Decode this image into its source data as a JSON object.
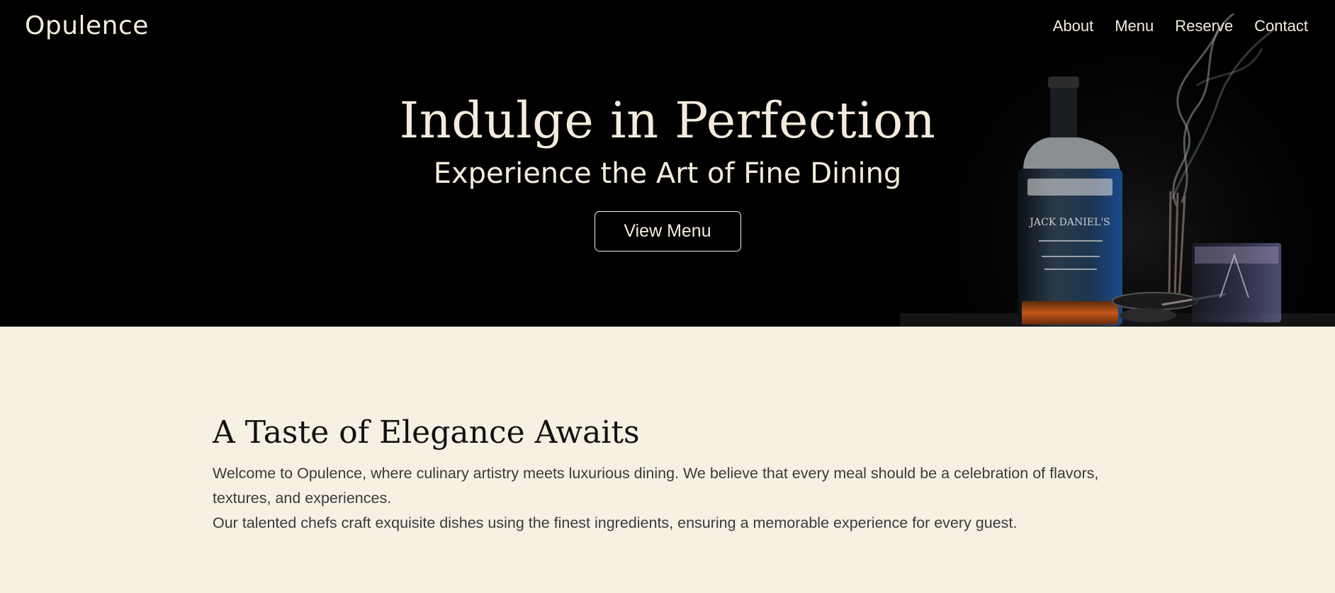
{
  "header": {
    "logo": "Opulence",
    "nav": [
      {
        "label": "About"
      },
      {
        "label": "Menu"
      },
      {
        "label": "Reserve"
      },
      {
        "label": "Contact"
      }
    ]
  },
  "hero": {
    "title": "Indulge in Perfection",
    "subtitle": "Experience the Art of Fine Dining",
    "cta_label": "View Menu",
    "bottle_label": "JACK DANIEL'S"
  },
  "intro": {
    "title": "A Taste of Elegance Awaits",
    "paragraph_1": "Welcome to Opulence, where culinary artistry meets luxurious dining. We believe that every meal should be a celebration of flavors, textures, and experiences.",
    "paragraph_2": "Our talented chefs craft exquisite dishes using the finest ingredients, ensuring a memorable experience for every guest."
  },
  "colors": {
    "hero_bg": "#000000",
    "cream_text": "#f3ecdc",
    "section_bg": "#f7f1e3",
    "heading_text": "#111111",
    "body_text": "#3a3a3a"
  }
}
